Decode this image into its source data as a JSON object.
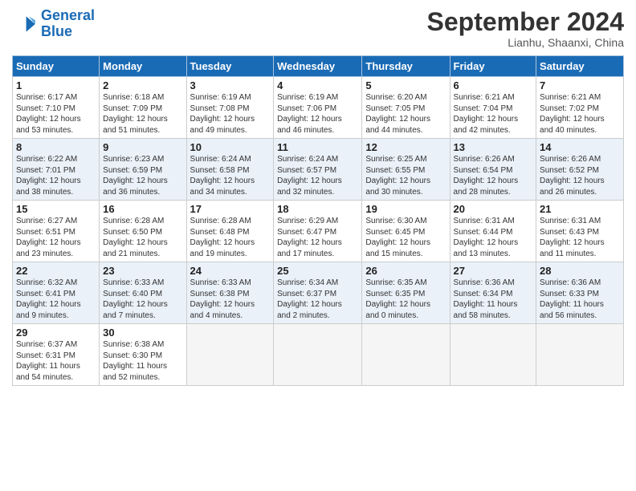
{
  "logo": {
    "line1": "General",
    "line2": "Blue"
  },
  "title": "September 2024",
  "location": "Lianhu, Shaanxi, China",
  "days_header": [
    "Sunday",
    "Monday",
    "Tuesday",
    "Wednesday",
    "Thursday",
    "Friday",
    "Saturday"
  ],
  "weeks": [
    [
      {
        "num": "1",
        "rise": "6:17 AM",
        "set": "7:10 PM",
        "daylight": "12 hours and 53 minutes."
      },
      {
        "num": "2",
        "rise": "6:18 AM",
        "set": "7:09 PM",
        "daylight": "12 hours and 51 minutes."
      },
      {
        "num": "3",
        "rise": "6:19 AM",
        "set": "7:08 PM",
        "daylight": "12 hours and 49 minutes."
      },
      {
        "num": "4",
        "rise": "6:19 AM",
        "set": "7:06 PM",
        "daylight": "12 hours and 46 minutes."
      },
      {
        "num": "5",
        "rise": "6:20 AM",
        "set": "7:05 PM",
        "daylight": "12 hours and 44 minutes."
      },
      {
        "num": "6",
        "rise": "6:21 AM",
        "set": "7:04 PM",
        "daylight": "12 hours and 42 minutes."
      },
      {
        "num": "7",
        "rise": "6:21 AM",
        "set": "7:02 PM",
        "daylight": "12 hours and 40 minutes."
      }
    ],
    [
      {
        "num": "8",
        "rise": "6:22 AM",
        "set": "7:01 PM",
        "daylight": "12 hours and 38 minutes."
      },
      {
        "num": "9",
        "rise": "6:23 AM",
        "set": "6:59 PM",
        "daylight": "12 hours and 36 minutes."
      },
      {
        "num": "10",
        "rise": "6:24 AM",
        "set": "6:58 PM",
        "daylight": "12 hours and 34 minutes."
      },
      {
        "num": "11",
        "rise": "6:24 AM",
        "set": "6:57 PM",
        "daylight": "12 hours and 32 minutes."
      },
      {
        "num": "12",
        "rise": "6:25 AM",
        "set": "6:55 PM",
        "daylight": "12 hours and 30 minutes."
      },
      {
        "num": "13",
        "rise": "6:26 AM",
        "set": "6:54 PM",
        "daylight": "12 hours and 28 minutes."
      },
      {
        "num": "14",
        "rise": "6:26 AM",
        "set": "6:52 PM",
        "daylight": "12 hours and 26 minutes."
      }
    ],
    [
      {
        "num": "15",
        "rise": "6:27 AM",
        "set": "6:51 PM",
        "daylight": "12 hours and 23 minutes."
      },
      {
        "num": "16",
        "rise": "6:28 AM",
        "set": "6:50 PM",
        "daylight": "12 hours and 21 minutes."
      },
      {
        "num": "17",
        "rise": "6:28 AM",
        "set": "6:48 PM",
        "daylight": "12 hours and 19 minutes."
      },
      {
        "num": "18",
        "rise": "6:29 AM",
        "set": "6:47 PM",
        "daylight": "12 hours and 17 minutes."
      },
      {
        "num": "19",
        "rise": "6:30 AM",
        "set": "6:45 PM",
        "daylight": "12 hours and 15 minutes."
      },
      {
        "num": "20",
        "rise": "6:31 AM",
        "set": "6:44 PM",
        "daylight": "12 hours and 13 minutes."
      },
      {
        "num": "21",
        "rise": "6:31 AM",
        "set": "6:43 PM",
        "daylight": "12 hours and 11 minutes."
      }
    ],
    [
      {
        "num": "22",
        "rise": "6:32 AM",
        "set": "6:41 PM",
        "daylight": "12 hours and 9 minutes."
      },
      {
        "num": "23",
        "rise": "6:33 AM",
        "set": "6:40 PM",
        "daylight": "12 hours and 7 minutes."
      },
      {
        "num": "24",
        "rise": "6:33 AM",
        "set": "6:38 PM",
        "daylight": "12 hours and 4 minutes."
      },
      {
        "num": "25",
        "rise": "6:34 AM",
        "set": "6:37 PM",
        "daylight": "12 hours and 2 minutes."
      },
      {
        "num": "26",
        "rise": "6:35 AM",
        "set": "6:35 PM",
        "daylight": "12 hours and 0 minutes."
      },
      {
        "num": "27",
        "rise": "6:36 AM",
        "set": "6:34 PM",
        "daylight": "11 hours and 58 minutes."
      },
      {
        "num": "28",
        "rise": "6:36 AM",
        "set": "6:33 PM",
        "daylight": "11 hours and 56 minutes."
      }
    ],
    [
      {
        "num": "29",
        "rise": "6:37 AM",
        "set": "6:31 PM",
        "daylight": "11 hours and 54 minutes."
      },
      {
        "num": "30",
        "rise": "6:38 AM",
        "set": "6:30 PM",
        "daylight": "11 hours and 52 minutes."
      },
      null,
      null,
      null,
      null,
      null
    ]
  ]
}
